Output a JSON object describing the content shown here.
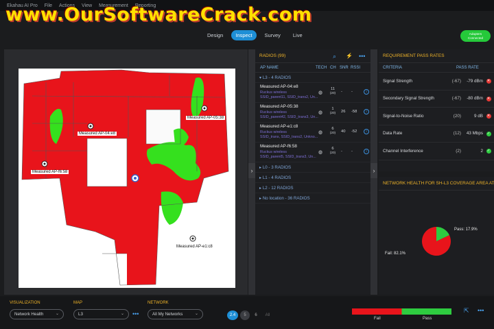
{
  "watermark": "www.OurSoftwareCrack.com",
  "menu": {
    "items": [
      "Ekahau AI Pro",
      "File",
      "Actions",
      "View",
      "Measurement",
      "Reporting"
    ]
  },
  "nav": {
    "tabs": [
      "Design",
      "Inspect",
      "Survey",
      "Live"
    ],
    "active": "Inspect"
  },
  "adapters": {
    "line1": "Adapters",
    "line2": "Connected"
  },
  "map": {
    "labels": [
      "Measured AP-04:e8",
      "Measured AP-05:38",
      "Measured AP-f6:58",
      "Measured AP-e1:c8"
    ]
  },
  "radios": {
    "title": "RADIOS (99)",
    "columns": {
      "ap": "AP NAME",
      "tech": "TECH",
      "ch": "CH",
      "snr": "SNR",
      "rssi": "RSSI"
    },
    "group_l3": "L3 - 4 RADIOS",
    "aps": [
      {
        "name": "Measured AP-04:e8",
        "vendor": "Ruckus wireless",
        "ssids": "SSID_parent11, SSID_trans2, Un...",
        "ch": "11",
        "ch_sub": "(20)",
        "snr": "-",
        "rssi": "-"
      },
      {
        "name": "Measured AP-05:38",
        "vendor": "Ruckus wireless",
        "ssids": "SSID_parent42, SSID_trans3, Un...",
        "ch": "1",
        "ch_sub": "(20)",
        "snr": "26",
        "rssi": "-58"
      },
      {
        "name": "Measured AP-e1:c8",
        "vendor": "Ruckus wireless",
        "ssids": "SSID_trans, SSID_trans2, Unkno...",
        "ch": "6",
        "ch_sub": "(20)",
        "snr": "40",
        "rssi": "-52"
      },
      {
        "name": "Measured AP-f6:58",
        "vendor": "Ruckus wireless",
        "ssids": "SSID_parent5, SSID_trans3, Un...",
        "ch": "6",
        "ch_sub": "(20)",
        "snr": "-",
        "rssi": "-"
      }
    ],
    "groups": [
      "L0 - 3 RADIOS",
      "L1 - 4 RADIOS",
      "L2 - 12 RADIOS",
      "No location - 36 RADIOS"
    ]
  },
  "requirements": {
    "title": "REQUIREMENT PASS RATES",
    "col_criteria": "CRITERIA",
    "col_pass": "PASS RATE",
    "rows": [
      {
        "name": "Signal Strength",
        "threshold": "(-67)",
        "value": "-79 dBm",
        "status": "fail"
      },
      {
        "name": "Secondary Signal Strength",
        "threshold": "(-67)",
        "value": "-80 dBm",
        "status": "fail"
      },
      {
        "name": "Signal-to-Noise Ratio",
        "threshold": "(20)",
        "value": "9 dB",
        "status": "fail"
      },
      {
        "name": "Data Rate",
        "threshold": "(12)",
        "value": "43 Mbps",
        "status": "pass"
      },
      {
        "name": "Channel Interference",
        "threshold": "(2)",
        "value": "2",
        "status": "pass"
      }
    ]
  },
  "health": {
    "title": "NETWORK HEALTH FOR SH-L3 COVERAGE AREA AT...",
    "pass_label": "Pass: 17.9%",
    "fail_label": "Fail: 82.1%",
    "pass_fraction": 0.179,
    "pass_color": "#2ecc40",
    "fail_color": "#e8141b"
  },
  "bottom": {
    "visualization_label": "VISUALIZATION",
    "visualization_value": "Network Health",
    "map_label": "MAP",
    "map_value": "L3",
    "network_label": "NETWORK",
    "network_value": "All My Networks",
    "bands": [
      "2.4",
      "5",
      "6",
      "All"
    ],
    "legend_fail": "Fail",
    "legend_pass": "Pass"
  }
}
